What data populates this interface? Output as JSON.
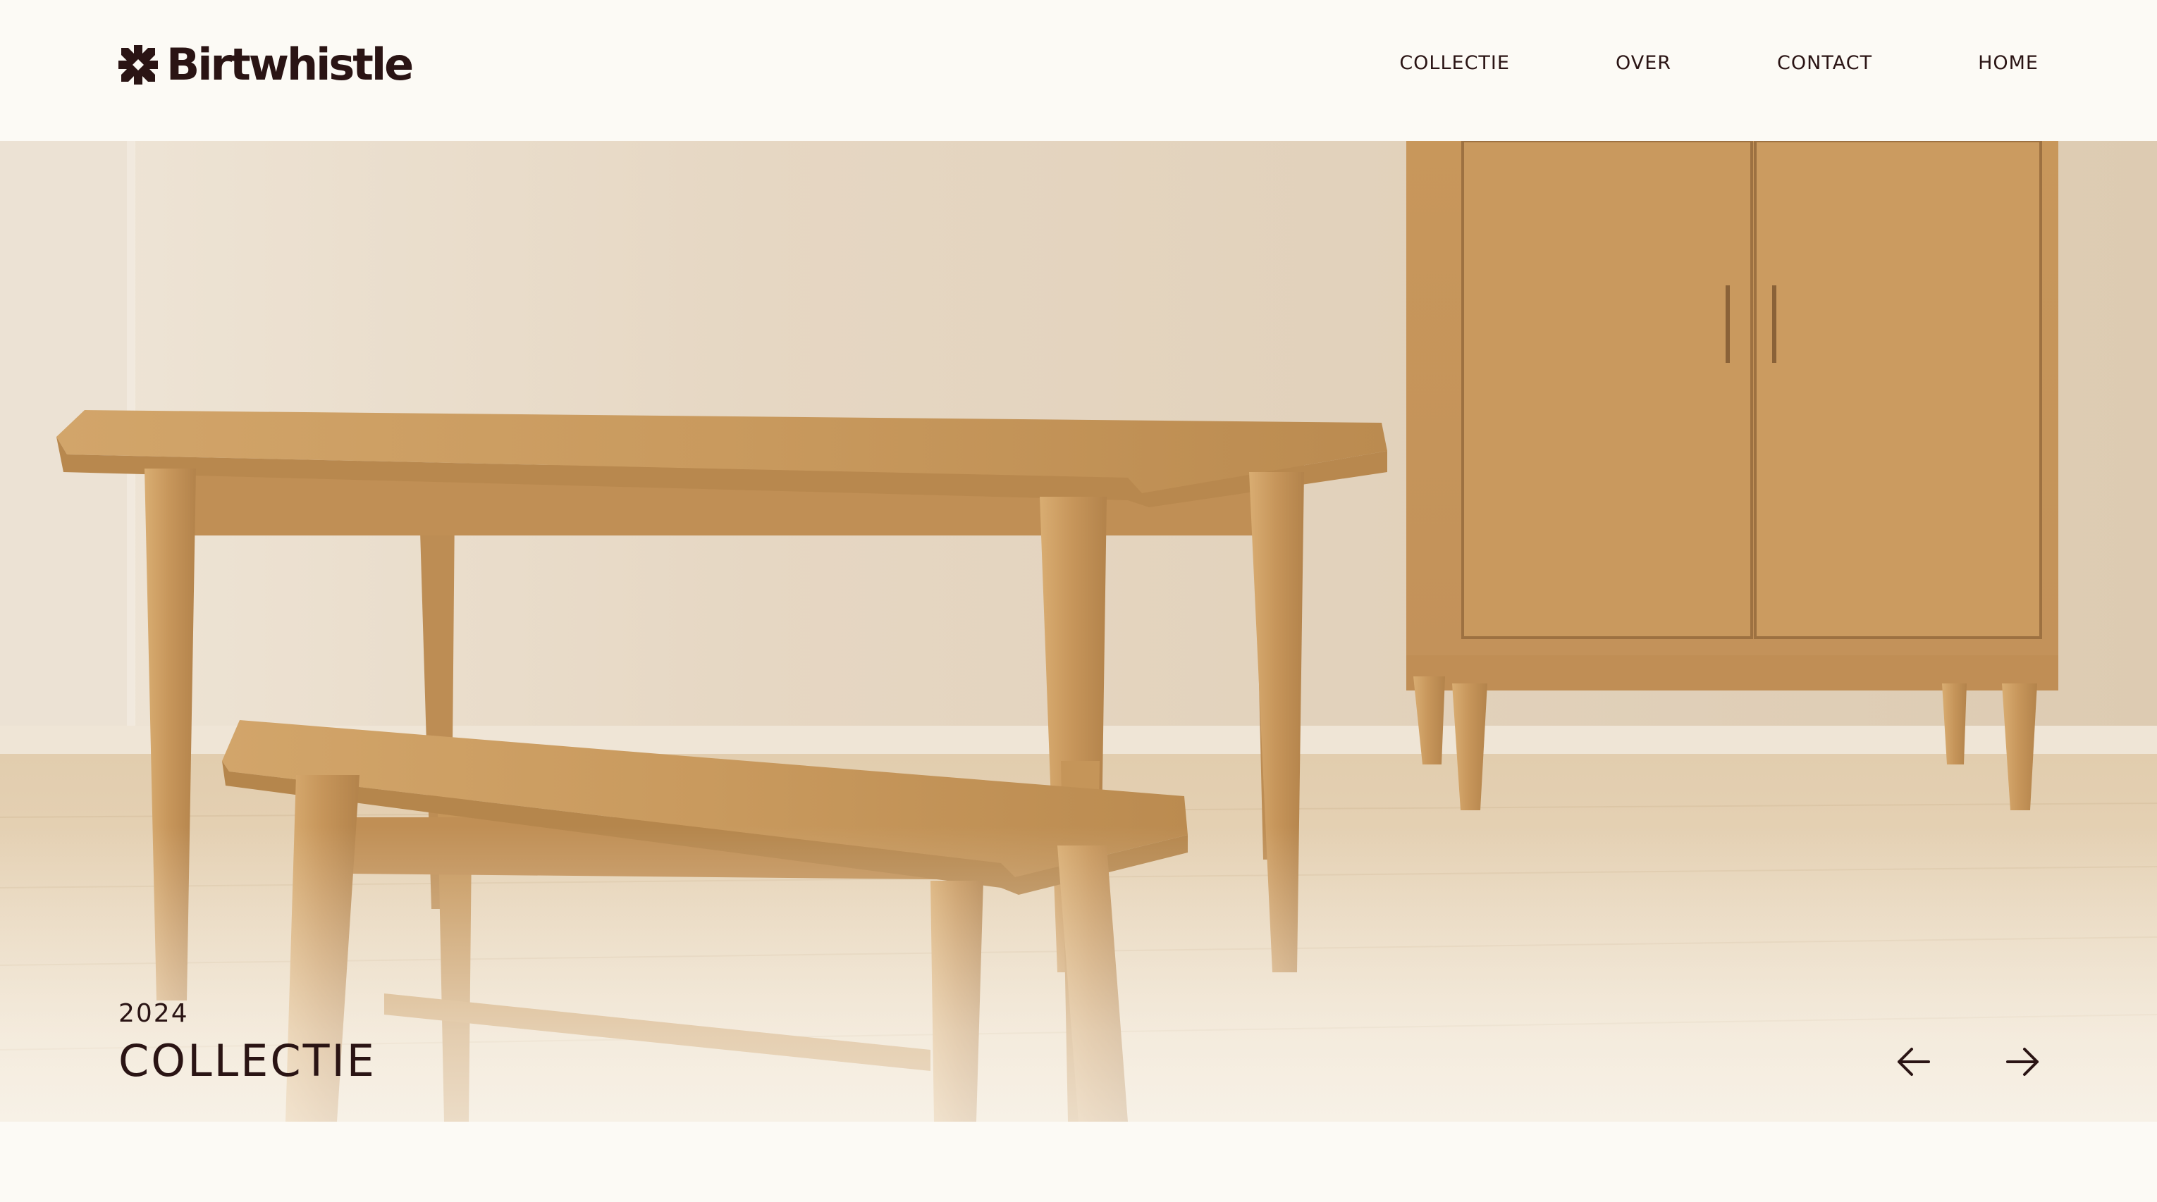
{
  "brand": {
    "name": "Birtwhistle",
    "logo_icon": "snowflake-cross-icon"
  },
  "nav": {
    "items": [
      {
        "label": "COLLECTIE"
      },
      {
        "label": "OVER"
      },
      {
        "label": "CONTACT"
      },
      {
        "label": "HOME"
      }
    ]
  },
  "hero": {
    "year": "2024",
    "title": "COLLECTIE",
    "prev_icon": "arrow-left-icon",
    "next_icon": "arrow-right-icon",
    "image_subject": "oak table, bench and cabinet"
  },
  "colors": {
    "background": "#fcfaf5",
    "text": "#2a1414",
    "wood": "#c99a5e",
    "wall": "#e6d7c2"
  }
}
